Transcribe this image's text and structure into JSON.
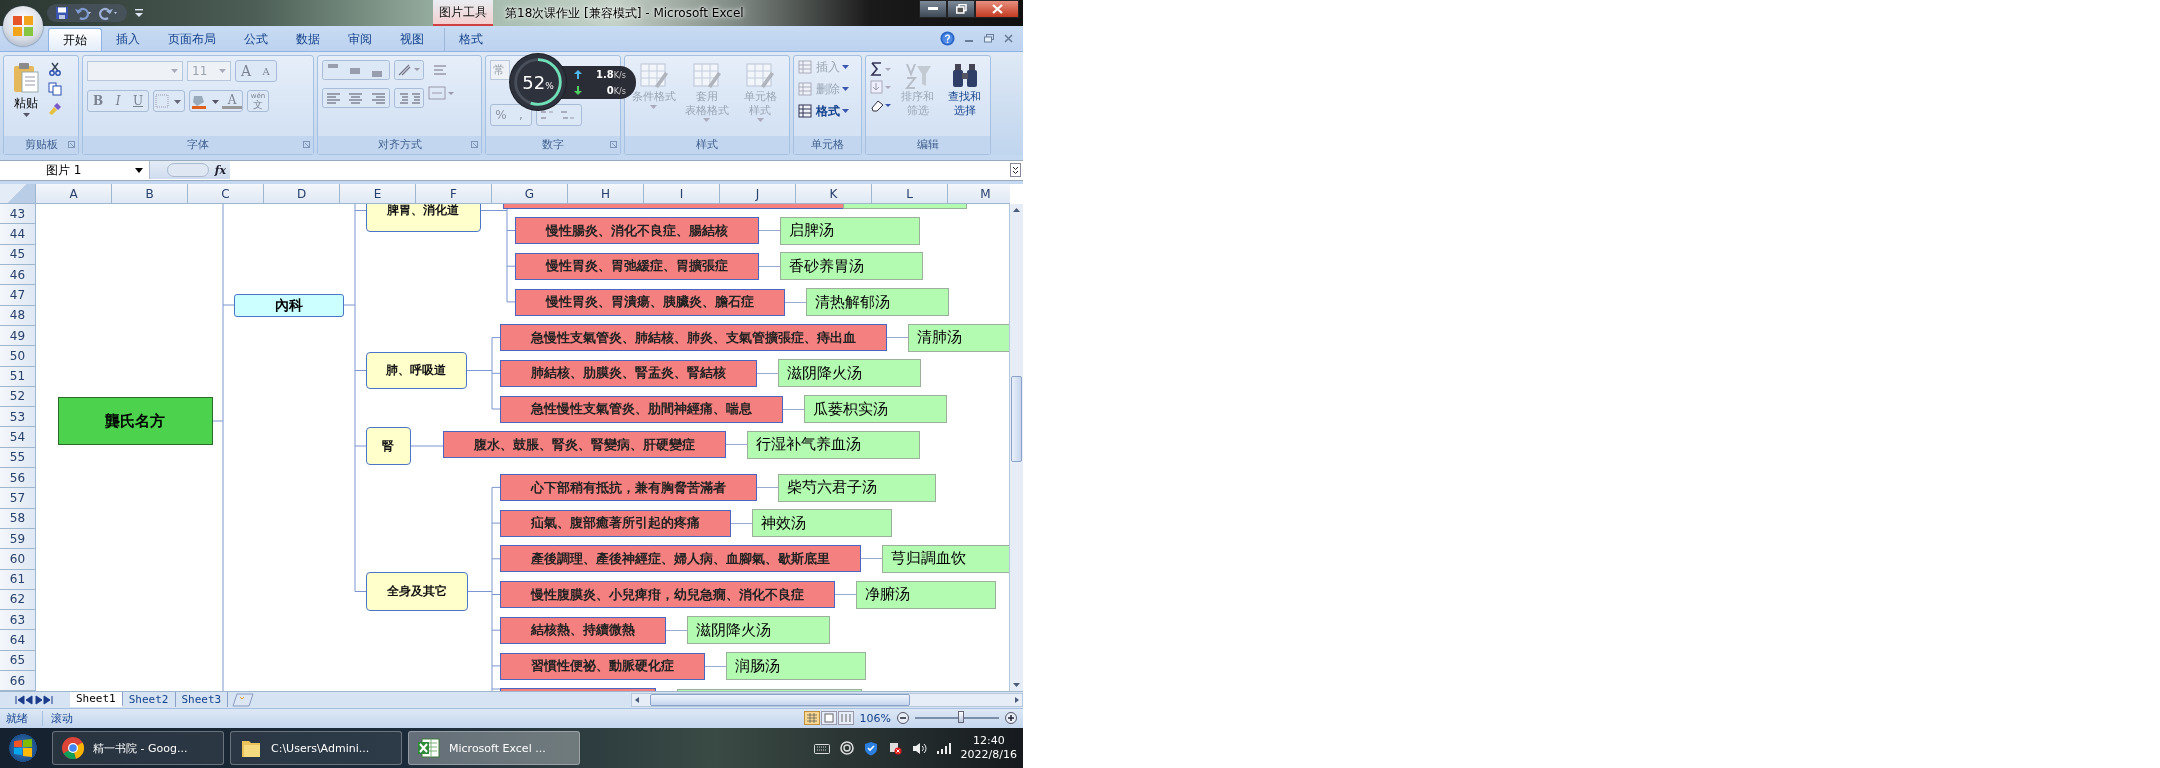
{
  "window": {
    "context_label": "图片工具",
    "title": "第18次课作业  [兼容模式] - Microsoft Excel"
  },
  "ribbon_tabs": [
    {
      "label": "开始",
      "selected": true,
      "kind": "normal"
    },
    {
      "label": "插入",
      "selected": false,
      "kind": "normal"
    },
    {
      "label": "页面布局",
      "selected": false,
      "kind": "normal"
    },
    {
      "label": "公式",
      "selected": false,
      "kind": "normal"
    },
    {
      "label": "数据",
      "selected": false,
      "kind": "normal"
    },
    {
      "label": "审阅",
      "selected": false,
      "kind": "normal"
    },
    {
      "label": "视图",
      "selected": false,
      "kind": "normal"
    },
    {
      "label": "格式",
      "selected": false,
      "kind": "contextual"
    }
  ],
  "clipboard": {
    "paste": "粘贴",
    "label": "剪贴板"
  },
  "font": {
    "size": "11",
    "label": "字体",
    "grow": "A",
    "shrink": "A",
    "bold": "B",
    "italic": "I",
    "underline": "U",
    "color_glyph": "A",
    "phonetic_top": "wén",
    "phonetic": "文"
  },
  "alignment": {
    "label": "对齐方式"
  },
  "number": {
    "format": "常",
    "percent": "%",
    "comma": ",",
    "label": "数字"
  },
  "styles": {
    "label": "样式",
    "buttons": [
      {
        "lines": [
          "条件格式"
        ],
        "disabled": true
      },
      {
        "lines": [
          "套用",
          "表格格式"
        ],
        "disabled": true
      },
      {
        "lines": [
          "单元格",
          "样式"
        ],
        "disabled": true
      }
    ]
  },
  "cells": {
    "label": "单元格",
    "buttons": [
      {
        "label": "插入",
        "disabled": true
      },
      {
        "label": "删除",
        "disabled": true
      },
      {
        "label": "格式",
        "disabled": false
      }
    ]
  },
  "editing": {
    "label": "编辑",
    "buttons": [
      {
        "lines": [
          "排序和",
          "筛选"
        ],
        "disabled": true
      },
      {
        "lines": [
          "查找和",
          "选择"
        ],
        "disabled": false
      }
    ]
  },
  "net_monitor": {
    "percent": "52",
    "percent_sign": "%",
    "upload": "1.8",
    "upload_unit": "K/s",
    "download": "0",
    "download_unit": "K/s"
  },
  "formula_bar": {
    "name_box": "图片 1",
    "fx": "fx"
  },
  "columns": [
    "A",
    "B",
    "C",
    "D",
    "E",
    "F",
    "G",
    "H",
    "I",
    "J",
    "K",
    "L",
    "M"
  ],
  "rows": [
    "43",
    "44",
    "45",
    "46",
    "47",
    "48",
    "49",
    "50",
    "51",
    "52",
    "53",
    "54",
    "55",
    "56",
    "57",
    "58",
    "59",
    "60",
    "61",
    "62",
    "63",
    "64",
    "65",
    "66"
  ],
  "mind_map": {
    "root": "龔氏名方",
    "branch": "內科",
    "categories": [
      {
        "label": "脾胃、消化道",
        "items": [
          {
            "symptoms": "慢性腸炎、消化不良症、腸結核",
            "remedy": "启脾汤"
          },
          {
            "symptoms": "慢性胃炎、胃弛緩症、胃擴張症",
            "remedy": "香砂养胃汤"
          },
          {
            "symptoms": "慢性胃炎、胃潰瘍、胰臟炎、膽石症",
            "remedy": "清热解郁汤"
          }
        ]
      },
      {
        "label": "肺、呼吸道",
        "items": [
          {
            "symptoms": "急慢性支氣管炎、肺結核、肺炎、支氣管擴張症、痔出血",
            "remedy": "清肺汤"
          },
          {
            "symptoms": "肺結核、肋膜炎、腎盂炎、腎結核",
            "remedy": "滋阴降火汤"
          },
          {
            "symptoms": "急性慢性支氣管炎、肋間神經痛、喘息",
            "remedy": "瓜蒌枳实汤"
          }
        ]
      },
      {
        "label": "腎",
        "items": [
          {
            "symptoms": "腹水、鼓脹、腎炎、腎變病、肝硬變症",
            "remedy": "行湿补气养血汤"
          }
        ]
      },
      {
        "label": "全身及其它",
        "items": [
          {
            "symptoms": "心下部稍有抵抗，兼有胸脅苦滿者",
            "remedy": "柴芍六君子汤"
          },
          {
            "symptoms": "疝氣、腹部癒著所引起的疼痛",
            "remedy": "神效汤"
          },
          {
            "symptoms": "產後調理、產後神經症、婦人病、血腳氣、歇斯底里",
            "remedy": "芎归調血饮"
          },
          {
            "symptoms": "慢性腹膜炎、小兒痺疳，幼兒急癇、消化不良症",
            "remedy": "净腑汤"
          },
          {
            "symptoms": "結核熱、持續微熱",
            "remedy": "滋阴降火汤"
          },
          {
            "symptoms": "習慣性便祕、動脈硬化症",
            "remedy": "润肠汤"
          }
        ]
      }
    ]
  },
  "sheet_tabs": [
    {
      "label": "Sheet1",
      "selected": true
    },
    {
      "label": "Sheet2",
      "selected": false
    },
    {
      "label": "Sheet3",
      "selected": false
    }
  ],
  "status_bar": {
    "mode": "就绪",
    "scroll": "滚动",
    "zoom": "106%",
    "zoom_slider": {
      "level": 0.55
    }
  },
  "taskbar": {
    "items": [
      {
        "label": "精一书院 - Goog...",
        "kind": "chrome",
        "selected": false
      },
      {
        "label": "C:\\Users\\Admini...",
        "kind": "folder",
        "selected": false
      },
      {
        "label": "Microsoft Excel ...",
        "kind": "excel",
        "selected": true
      }
    ],
    "time": "12:40",
    "date": "2022/8/16"
  }
}
